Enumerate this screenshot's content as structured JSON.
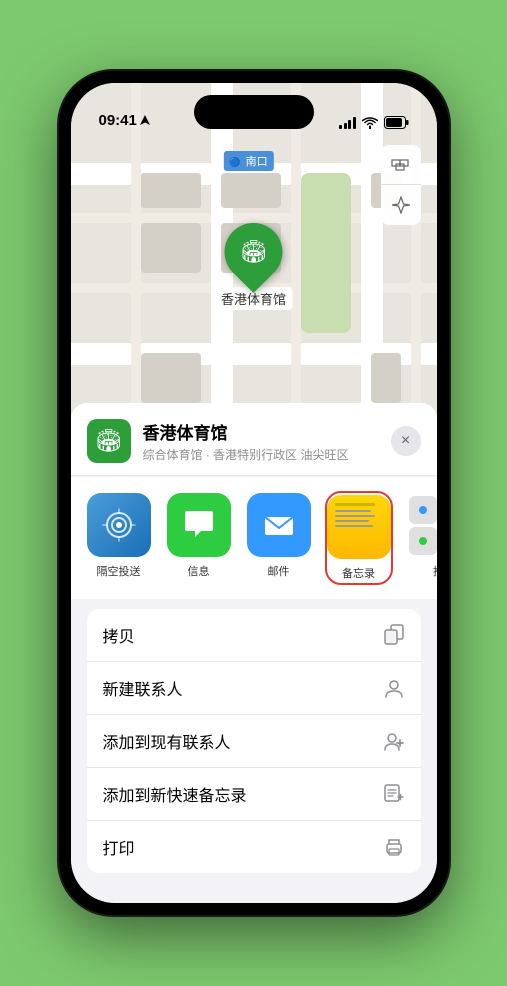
{
  "status_bar": {
    "time": "09:41",
    "location_arrow": "▶"
  },
  "map": {
    "north_label": "南口",
    "venue_pin_label": "香港体育馆"
  },
  "map_controls": {
    "map_icon": "🗺",
    "location_icon": "◁"
  },
  "sheet": {
    "venue_name": "香港体育馆",
    "venue_desc": "综合体育馆 · 香港特别行政区 油尖旺区",
    "close_label": "×"
  },
  "share_items": [
    {
      "id": "airdrop",
      "label": "隔空投送",
      "icon": "📡"
    },
    {
      "id": "messages",
      "label": "信息",
      "icon": "💬"
    },
    {
      "id": "mail",
      "label": "邮件",
      "icon": "✉"
    },
    {
      "id": "notes",
      "label": "备忘录",
      "icon": "notes"
    },
    {
      "id": "more",
      "label": "推",
      "icon": "···"
    }
  ],
  "actions": [
    {
      "id": "copy",
      "label": "拷贝",
      "icon": "⎘"
    },
    {
      "id": "new-contact",
      "label": "新建联系人",
      "icon": "👤"
    },
    {
      "id": "add-contact",
      "label": "添加到现有联系人",
      "icon": "👤+"
    },
    {
      "id": "quick-note",
      "label": "添加到新快速备忘录",
      "icon": "📝"
    },
    {
      "id": "print",
      "label": "打印",
      "icon": "🖨"
    }
  ]
}
